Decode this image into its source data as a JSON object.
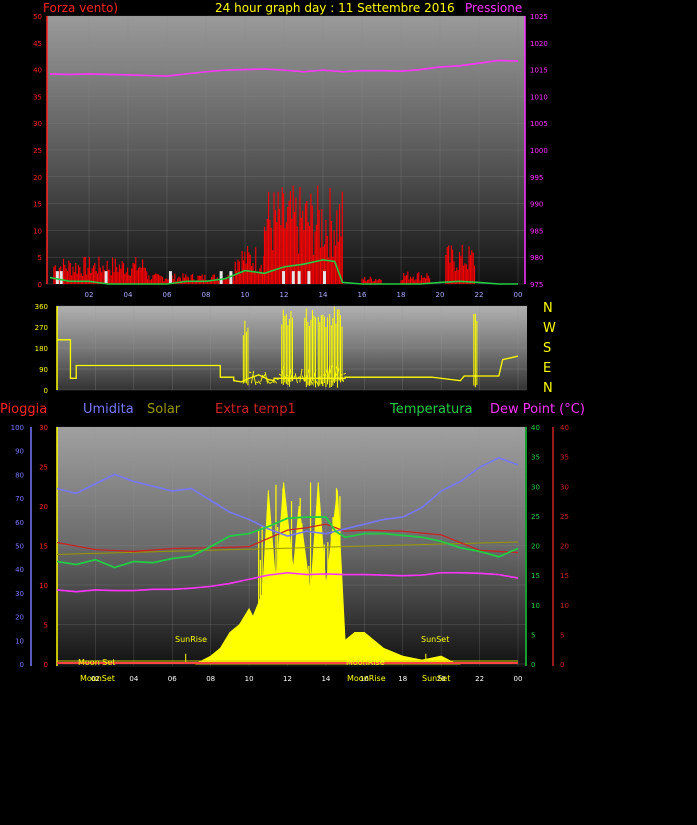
{
  "title": "24 hour graph day : 11 Settembre 2016",
  "colors": {
    "wind": "#ff0000",
    "wind_avg": "#22cc44",
    "gust_white": "#e6e6e6",
    "pressure": "#ff33ff",
    "dir": "#ffff00",
    "humidity": "#7777ff",
    "solar": "#ffff00",
    "temp": "#22cc44",
    "dew": "#ff33ff",
    "extra": "#cc2222",
    "rain": "#ff4444",
    "olive": "#999900"
  },
  "x_ticks": [
    "02",
    "04",
    "06",
    "08",
    "10",
    "12",
    "14",
    "16",
    "18",
    "20",
    "22",
    "00"
  ],
  "chart_data": [
    {
      "type": "line",
      "name": "wind-pressure",
      "left_label": "Forza vento)",
      "right_label": "Pressione",
      "left_ticks": [
        "50",
        "45",
        "40",
        "35",
        "30",
        "25",
        "20",
        "15",
        "10",
        "5",
        "0"
      ],
      "right_ticks": [
        "1025",
        "1020",
        "1015",
        "1010",
        "1005",
        "1000",
        "995",
        "990",
        "985",
        "980",
        "975"
      ],
      "ylim_left": [
        0,
        50
      ],
      "ylim_right": [
        975,
        1025
      ],
      "xlim": [
        0,
        24
      ],
      "pressure": {
        "x": [
          0,
          1,
          2,
          3,
          4,
          5,
          6,
          7,
          8,
          9,
          10,
          11,
          12,
          13,
          14,
          15,
          16,
          17,
          18,
          19,
          20,
          21,
          22,
          23,
          24
        ],
        "y": [
          1014.2,
          1014.1,
          1014.2,
          1014.1,
          1014.0,
          1013.9,
          1013.8,
          1014.2,
          1014.6,
          1014.9,
          1015.0,
          1015.1,
          1014.9,
          1014.6,
          1014.9,
          1014.6,
          1014.8,
          1014.8,
          1014.7,
          1015.0,
          1015.5,
          1015.7,
          1016.2,
          1016.7,
          1016.6
        ]
      },
      "wind_avg": {
        "x": [
          0,
          1,
          2,
          3,
          4,
          5,
          6,
          7,
          8,
          9,
          10,
          11,
          12,
          13,
          14,
          14.6,
          15,
          16,
          17,
          18,
          19,
          20,
          21,
          22,
          23,
          24
        ],
        "y": [
          1.2,
          0.5,
          0.5,
          0,
          0,
          0,
          0,
          0.5,
          0.5,
          1,
          2.5,
          2,
          3.2,
          3.7,
          4.5,
          4.2,
          0.3,
          0,
          0,
          0,
          0,
          0.3,
          0.5,
          0.3,
          0,
          0
        ]
      },
      "wind_peak_ranges": [
        {
          "from": 0.2,
          "to": 5.0,
          "max": 5.2
        },
        {
          "from": 5.0,
          "to": 9.5,
          "max": 2.0
        },
        {
          "from": 9.5,
          "to": 11.0,
          "max": 7.5
        },
        {
          "from": 11.0,
          "to": 15.0,
          "max": 18.5
        },
        {
          "from": 16.0,
          "to": 17.0,
          "max": 1.5
        },
        {
          "from": 18.0,
          "to": 19.5,
          "max": 2.5
        },
        {
          "from": 20.3,
          "to": 21.8,
          "max": 7.5
        }
      ]
    },
    {
      "type": "line",
      "name": "wind-direction",
      "left_ticks": [
        "360",
        "270",
        "180",
        "90",
        "0"
      ],
      "right_labels": [
        "N",
        "W",
        "S",
        "E",
        "N"
      ],
      "ylim": [
        0,
        360
      ],
      "xlim": [
        0,
        24
      ],
      "x": [
        0,
        0.7,
        0.7,
        1,
        1,
        6,
        7,
        8.5,
        8.5,
        9.2,
        9.2,
        9.6,
        10,
        10.5,
        11,
        11.3,
        11.3,
        15,
        15,
        19.5,
        20.5,
        21,
        21.2,
        21.4,
        21.6,
        22,
        23,
        23.2,
        24
      ],
      "y": [
        215,
        215,
        50,
        50,
        105,
        105,
        105,
        105,
        55,
        55,
        40,
        35,
        50,
        65,
        45,
        40,
        50,
        50,
        55,
        55,
        45,
        40,
        60,
        60,
        60,
        60,
        60,
        130,
        145
      ],
      "spike_ranges": [
        {
          "from": 9.7,
          "to": 10.0,
          "max": 300
        },
        {
          "from": 11.7,
          "to": 12.3,
          "max": 360
        },
        {
          "from": 12.9,
          "to": 13.5,
          "max": 360
        },
        {
          "from": 13.6,
          "to": 14.1,
          "max": 360
        },
        {
          "from": 14.2,
          "to": 14.9,
          "max": 360
        },
        {
          "from": 21.7,
          "to": 21.9,
          "max": 360
        }
      ]
    },
    {
      "type": "line",
      "name": "humidity-solar-temperature",
      "legend": [
        "Pioggia",
        "Umidita",
        "Solar",
        "Extra temp1",
        "Temperatura",
        "Dew Point (°C)"
      ],
      "xlim": [
        0,
        24
      ],
      "axis_rain_ticks": [
        "100",
        "90",
        "80",
        "70",
        "60",
        "50",
        "40",
        "30",
        "20",
        "10",
        "0"
      ],
      "axis_left_ticks": [
        "30",
        "25",
        "20",
        "15",
        "10",
        "5",
        "0"
      ],
      "axis_right_ticks": [
        "40",
        "35",
        "30",
        "25",
        "20",
        "15",
        "10",
        "5",
        "0"
      ],
      "humidity": {
        "x": [
          0,
          0.5,
          1,
          2,
          3,
          4,
          5,
          6,
          7,
          8,
          9,
          10,
          11,
          12,
          13,
          14,
          15,
          16,
          17,
          18,
          19,
          20,
          21,
          22,
          23,
          24
        ],
        "y": [
          74,
          73,
          72,
          76,
          80,
          77,
          75,
          73,
          74,
          69,
          64,
          61,
          57,
          54,
          56,
          55,
          57,
          59,
          61,
          62,
          66,
          73,
          77,
          83,
          87,
          84
        ]
      },
      "temperature": {
        "x": [
          0,
          1,
          2,
          3,
          4,
          5,
          6,
          7,
          8,
          9,
          10,
          11,
          12,
          13,
          14,
          14.5,
          15,
          16,
          17,
          18,
          19,
          20,
          21,
          22,
          23,
          24
        ],
        "y": [
          17.3,
          16.8,
          17.6,
          16.3,
          17.3,
          17.1,
          17.8,
          18.2,
          19.8,
          21.6,
          22.0,
          23.2,
          24.6,
          24.8,
          24.8,
          22.4,
          21.4,
          22.0,
          22.0,
          21.7,
          21.4,
          20.7,
          19.6,
          19.0,
          18.1,
          19.5
        ]
      },
      "dew_point": {
        "x": [
          0,
          1,
          2,
          3,
          4,
          5,
          6,
          7,
          8,
          9,
          10,
          11,
          12,
          13,
          14,
          15,
          16,
          17,
          18,
          19,
          20,
          21,
          22,
          23,
          24
        ],
        "y": [
          12.5,
          12.2,
          12.5,
          12.4,
          12.4,
          12.6,
          12.6,
          12.8,
          13.1,
          13.6,
          14.3,
          15.0,
          15.4,
          15.1,
          15.2,
          15.1,
          15.1,
          15.0,
          14.9,
          15.0,
          15.4,
          15.4,
          15.3,
          15.1,
          14.5
        ]
      },
      "extra_temp": {
        "x": [
          0,
          2,
          4,
          6,
          8,
          10,
          12,
          13,
          14,
          15,
          16,
          18,
          20,
          22,
          24
        ],
        "y": [
          20.5,
          19.3,
          19.0,
          19.5,
          19.6,
          19.8,
          22.6,
          23.0,
          23.6,
          22.4,
          22.6,
          22.4,
          21.8,
          19.2,
          18.8
        ]
      },
      "olive_line": {
        "x": [
          0,
          24
        ],
        "y": [
          18.5,
          20.6
        ]
      },
      "solar": {
        "x": [
          7.2,
          8,
          8.5,
          9,
          9.5,
          10,
          10.2,
          10.7,
          11,
          11.4,
          11.8,
          12.3,
          12.6,
          13.2,
          13.6,
          14,
          14.6,
          15,
          15.5,
          16,
          17,
          18,
          19,
          20,
          20.8,
          21
        ],
        "y": [
          0,
          1,
          2,
          4,
          5,
          7,
          6,
          9,
          22,
          10,
          23,
          12,
          20,
          9,
          23,
          10,
          22,
          3,
          4,
          4,
          2,
          1,
          0.5,
          1,
          0,
          0
        ]
      },
      "sun_labels": [
        "SunRise",
        "SunSet"
      ],
      "moon_labels": [
        "Moon Set",
        "MoonSet",
        "MoonRise",
        "MoonRise",
        "SunSet"
      ]
    }
  ]
}
